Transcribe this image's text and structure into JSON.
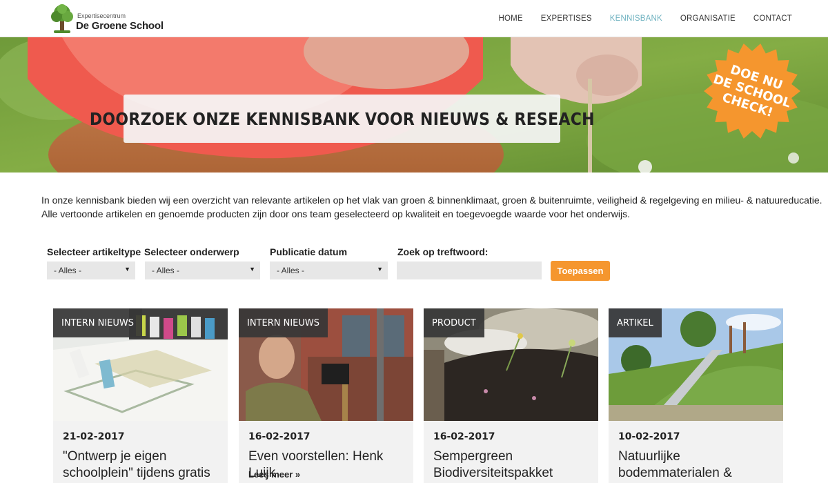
{
  "header": {
    "logo_small": "Expertisecentrum",
    "logo_big": "De Groene School",
    "nav": [
      {
        "label": "HOME"
      },
      {
        "label": "EXPERTISES"
      },
      {
        "label": "KENNISBANK",
        "active": true
      },
      {
        "label": "ORGANISATIE"
      },
      {
        "label": "CONTACT"
      }
    ],
    "active_color": "#6fb2c0"
  },
  "hero": {
    "title": "DOORZOEK ONZE KENNISBANK VOOR NIEUWS & RESEACH",
    "badge_lines": [
      "DOE NU",
      "DE SCHOOL",
      "CHECK!"
    ],
    "badge_color": "#f5962e"
  },
  "intro": {
    "line1": "In onze kennisbank bieden wij een overzicht van relevante artikelen op het vlak van groen & binnenklimaat, groen & buitenruimte, veiligheid & regelgeving en milieu- & natuureducatie.",
    "line2": "Alle vertoonde artikelen en genoemde producten zijn door ons team geselecteerd op kwaliteit en toegevoegde waarde voor het onderwijs."
  },
  "filters": {
    "type_label": "Selecteer artikeltype",
    "type_value": "- Alles -",
    "subject_label": "Selecteer onderwerp",
    "subject_value": "- Alles -",
    "date_label": "Publicatie datum",
    "date_value": "- Alles -",
    "keyword_label": "Zoek op treftwoord:",
    "keyword_value": "",
    "apply_label": "Toepassen"
  },
  "cards": [
    {
      "tag": "INTERN NIEUWS",
      "date": "21-02-2017",
      "title": "\"Ontwerp je eigen schoolplein\" tijdens gratis",
      "more": ""
    },
    {
      "tag": "INTERN NIEUWS",
      "date": "16-02-2017",
      "title": "Even voorstellen: Henk Luijk",
      "more": "Lees meer »"
    },
    {
      "tag": "PRODUCT",
      "date": "16-02-2017",
      "title": "Sempergreen Biodiversiteitspakket",
      "more": ""
    },
    {
      "tag": "ARTIKEL",
      "date": "10-02-2017",
      "title": "Natuurlijke bodemmaterialen &",
      "more": ""
    }
  ]
}
